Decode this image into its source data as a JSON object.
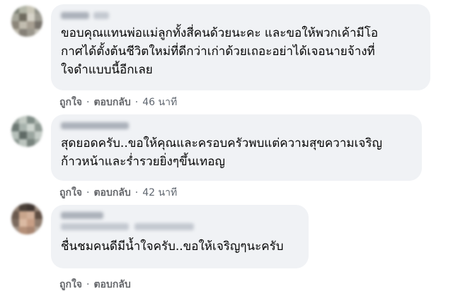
{
  "comments": [
    {
      "text_lines": [
        "ขอบคุณแทนพ่อแม่ลูกทั้งสี่คนด้วยนะคะ และขอให้พวกเค้ามีโอ",
        "กาศได้ตั้งต้นชีวิตใหม่ที่ดีกว่าเก่าด้วยเถอะอย่าได้เจอนายจ้างที่",
        "ใจดำแบบนี้อีกเลย"
      ],
      "like_label": "ถูกใจ",
      "reply_label": "ตอบกลับ",
      "time": "46 นาที"
    },
    {
      "text_lines": [
        "สุดยอดครับ..ขอให้คุณและครอบครัวพบแต่ความสุขความเจริญ",
        "ก้าวหน้าและร่ำรวยยิ่งๆขึ้นเทอญ"
      ],
      "like_label": "ถูกใจ",
      "reply_label": "ตอบกลับ",
      "time": "42 นาที"
    },
    {
      "text_lines": [
        "ชื่นชมคนดีมีน้ำใจครับ..ขอให้เจริญๆนะครับ"
      ],
      "like_label": "ถูกใจ",
      "reply_label": "ตอบกลับ",
      "time": ""
    }
  ],
  "separator": "·"
}
